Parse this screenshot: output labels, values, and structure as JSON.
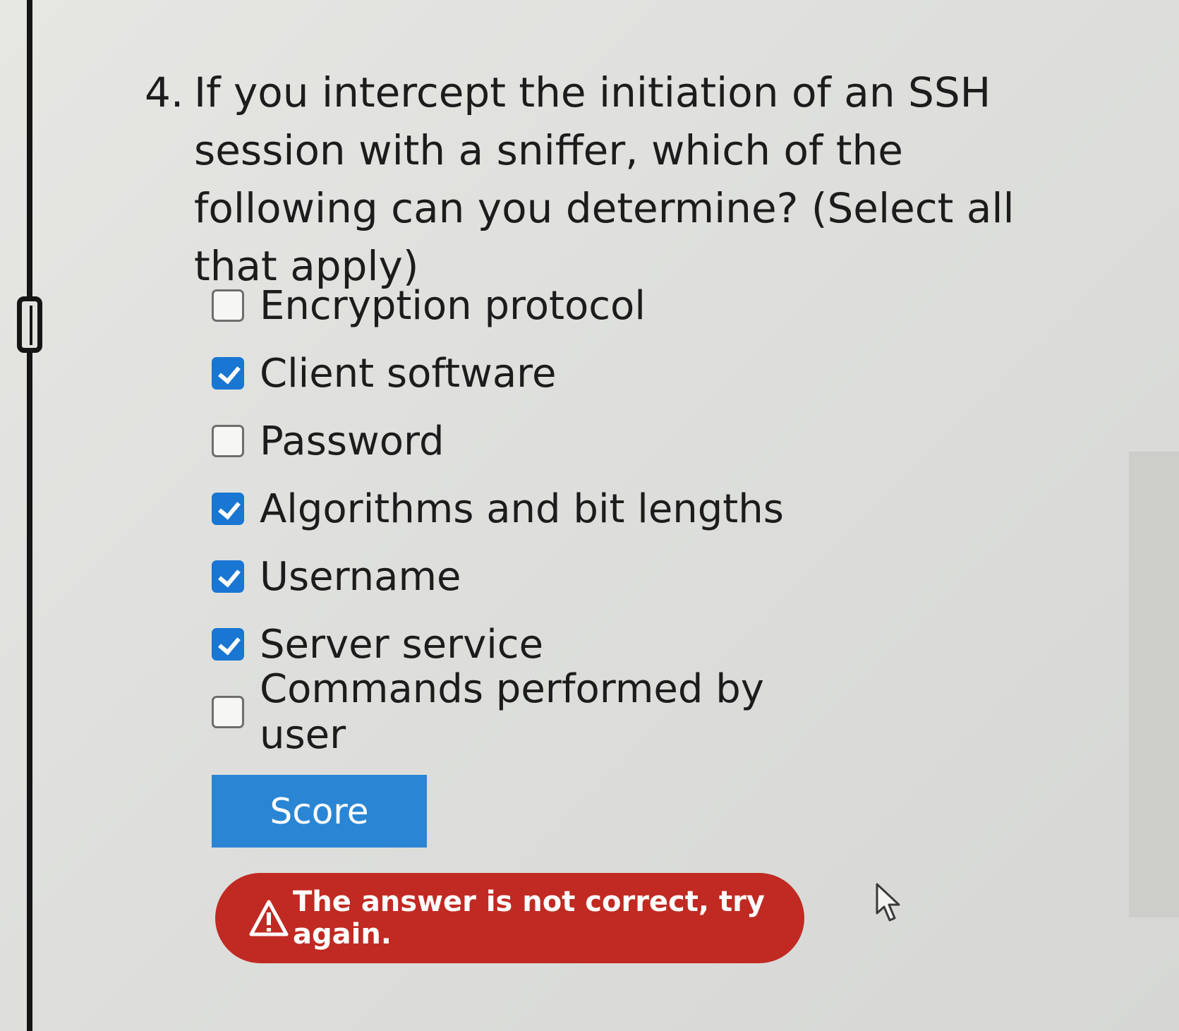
{
  "question": {
    "number": "4.",
    "text": "If you intercept the initiation of an SSH session with a sniffer, which of the following can you determine? (Select all that apply)"
  },
  "options": [
    {
      "label": "Encryption protocol",
      "checked": false
    },
    {
      "label": "Client software",
      "checked": true
    },
    {
      "label": "Password",
      "checked": false
    },
    {
      "label": "Algorithms and bit lengths",
      "checked": true
    },
    {
      "label": "Username",
      "checked": true
    },
    {
      "label": "Server service",
      "checked": true
    },
    {
      "label": "Commands performed by user",
      "checked": false
    }
  ],
  "score_button": {
    "label": "Score"
  },
  "alert": {
    "icon": "warning-icon",
    "text": "The answer is not correct, try again."
  },
  "colors": {
    "accent": "#1976d2",
    "button": "#2a86d4",
    "alert": "#c02a22"
  }
}
